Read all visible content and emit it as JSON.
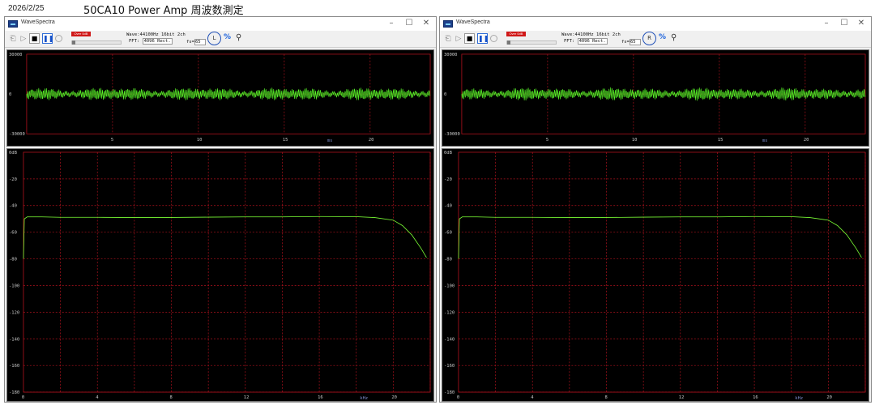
{
  "document": {
    "date": "2026/2/25",
    "title": "50CA10 Power Amp 周波数測定"
  },
  "colors": {
    "trace": "#7bff35",
    "grid": "#b0121e",
    "highlight_ring": "#2151b8",
    "level_meter": "#d01818"
  },
  "windows": [
    {
      "title": "WaveSpectra",
      "controls": {
        "minimize": "–",
        "maximize": "☐",
        "close": "✕"
      },
      "toolbar": {
        "level_text": "Over 0dB",
        "wave_info": "Wave:44100Hz 16bit 2ch",
        "fft_label": "FFT:",
        "fft_value": "4096 Rect.",
        "fs_label": "fs=",
        "fs_value": "65",
        "highlighted_tool": "Lch-icon",
        "highlighted_label": "L",
        "icons": [
          "open-file-icon",
          "play-icon",
          "stop-icon",
          "pause-icon",
          "record-icon",
          "percent-icon",
          "magnifier-icon"
        ]
      },
      "waveform": {
        "y_ticks": [
          "30000",
          "0",
          "-30000"
        ],
        "x_ticks": [
          "5",
          "10",
          "15",
          "20"
        ],
        "x_unit": "ms"
      },
      "spectrum": {
        "y_ticks": [
          "0dB",
          "-20",
          "-40",
          "-60",
          "-80",
          "-100",
          "-120",
          "-140",
          "-160",
          "-180"
        ],
        "x_ticks": [
          "0",
          "4",
          "8",
          "12",
          "16",
          "20"
        ],
        "x_unit": "kHz"
      }
    },
    {
      "title": "WaveSpectra",
      "controls": {
        "minimize": "–",
        "maximize": "☐",
        "close": "✕"
      },
      "toolbar": {
        "level_text": "Over 0dB",
        "wave_info": "Wave:44100Hz 16bit 2ch",
        "fft_label": "FFT:",
        "fft_value": "4096 Rect.",
        "fs_label": "fs=",
        "fs_value": "65",
        "highlighted_tool": "Rch-icon",
        "highlighted_label": "R",
        "icons": [
          "open-file-icon",
          "play-icon",
          "stop-icon",
          "pause-icon",
          "record-icon",
          "percent-icon",
          "magnifier-icon"
        ]
      },
      "waveform": {
        "y_ticks": [
          "30000",
          "0",
          "-30000"
        ],
        "x_ticks": [
          "5",
          "10",
          "15",
          "20"
        ],
        "x_unit": "ms"
      },
      "spectrum": {
        "y_ticks": [
          "0dB",
          "-20",
          "-40",
          "-60",
          "-80",
          "-100",
          "-120",
          "-140",
          "-160",
          "-180"
        ],
        "x_ticks": [
          "0",
          "4",
          "8",
          "12",
          "16",
          "20"
        ],
        "x_unit": "kHz"
      }
    }
  ],
  "chart_data": [
    {
      "type": "line",
      "chart": "spectrum-left",
      "xlim": [
        0,
        22
      ],
      "ylim": [
        -180,
        0
      ],
      "x": [
        0.0,
        0.05,
        0.2,
        1,
        2,
        4,
        6,
        8,
        10,
        12,
        14,
        16,
        18,
        19,
        20,
        20.5,
        21,
        21.5,
        21.8
      ],
      "y": [
        -80,
        -50,
        -48.5,
        -48.5,
        -48.8,
        -48.8,
        -49,
        -48.9,
        -48.7,
        -48.5,
        -48.5,
        -48.2,
        -48.3,
        -49,
        -51,
        -55,
        -62,
        -72,
        -79
      ]
    },
    {
      "type": "line",
      "chart": "spectrum-right",
      "xlim": [
        0,
        22
      ],
      "ylim": [
        -180,
        0
      ],
      "x": [
        0.0,
        0.05,
        0.2,
        1,
        2,
        4,
        6,
        8,
        10,
        12,
        14,
        16,
        18,
        19,
        20,
        20.5,
        21,
        21.5,
        21.8
      ],
      "y": [
        -80,
        -50,
        -48.5,
        -48.5,
        -48.8,
        -48.8,
        -49,
        -48.9,
        -48.7,
        -48.5,
        -48.5,
        -48.2,
        -48.3,
        -49,
        -51,
        -55,
        -62,
        -72,
        -79
      ]
    }
  ]
}
